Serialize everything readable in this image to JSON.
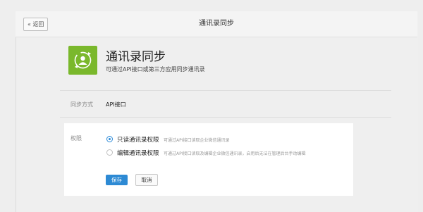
{
  "topbar": {
    "back_label": "« 返回",
    "title": "通讯录同步"
  },
  "app": {
    "icon": "sync-contacts-icon",
    "title": "通讯录同步",
    "description": "可通过API接口或第三方应用同步通讯录"
  },
  "sync_method": {
    "label": "同步方式",
    "value": "API接口"
  },
  "permission": {
    "label": "权限",
    "options": [
      {
        "title": "只读通讯录权限",
        "hint": "可通过API接口读取企业微信通讯录",
        "selected": true
      },
      {
        "title": "编辑通讯录权限",
        "hint": "可通过API接口读取及编辑企业微信通讯录，启用后无法在管理后台手动编辑",
        "selected": false
      }
    ]
  },
  "actions": {
    "save_label": "保存",
    "cancel_label": "取消"
  },
  "colors": {
    "accent": "#2d8ad4",
    "icon_bg": "#7ab82c"
  }
}
